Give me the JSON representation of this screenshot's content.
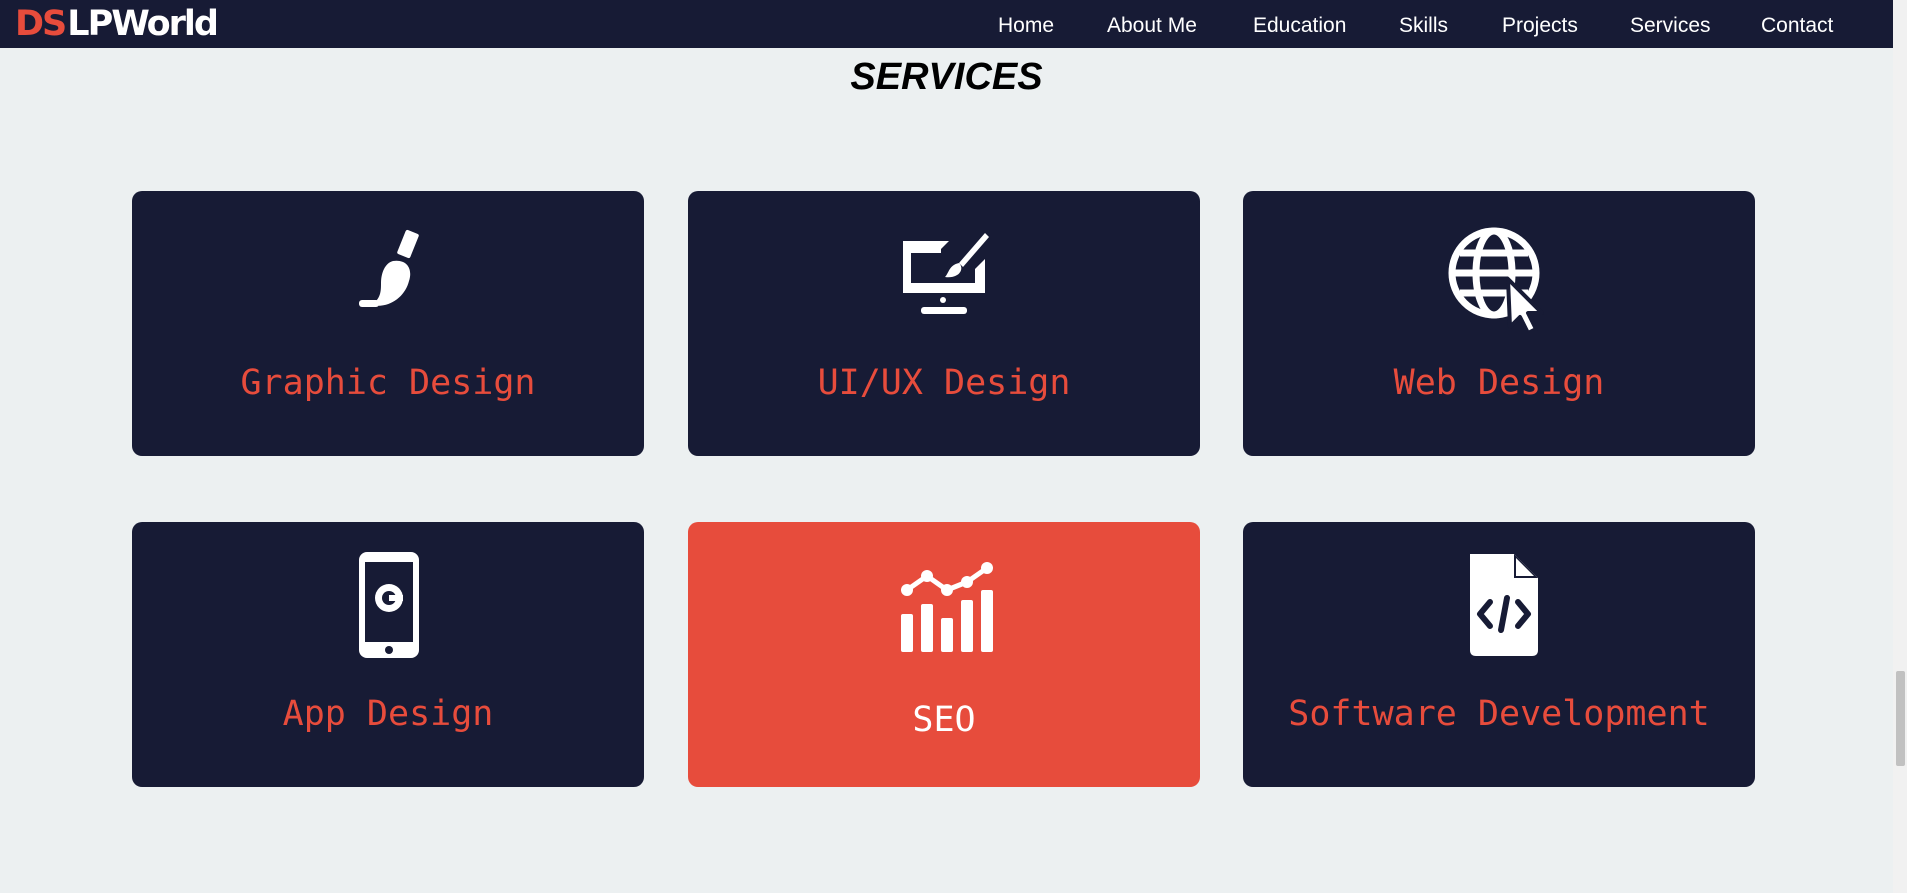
{
  "brand": {
    "accent": "DS",
    "rest": "LPWorld"
  },
  "nav": {
    "items": [
      {
        "label": "Home"
      },
      {
        "label": "About Me"
      },
      {
        "label": "Education"
      },
      {
        "label": "Skills"
      },
      {
        "label": "Projects"
      },
      {
        "label": "Services"
      },
      {
        "label": "Contact"
      }
    ]
  },
  "services": {
    "title": "SERVICES",
    "cards": [
      {
        "label": "Graphic Design",
        "icon": "paintbrush-icon"
      },
      {
        "label": "UI/UX Design",
        "icon": "monitor-design-icon"
      },
      {
        "label": "Web Design",
        "icon": "globe-cursor-icon"
      },
      {
        "label": "App Design",
        "icon": "smartphone-icon"
      },
      {
        "label": "SEO",
        "icon": "analytics-chart-icon",
        "active": true
      },
      {
        "label": "Software Development",
        "icon": "code-file-icon"
      }
    ]
  },
  "colors": {
    "navbar": "#171b35",
    "card": "#171b35",
    "accent": "#e74c3c",
    "background": "#ecf0f1"
  }
}
